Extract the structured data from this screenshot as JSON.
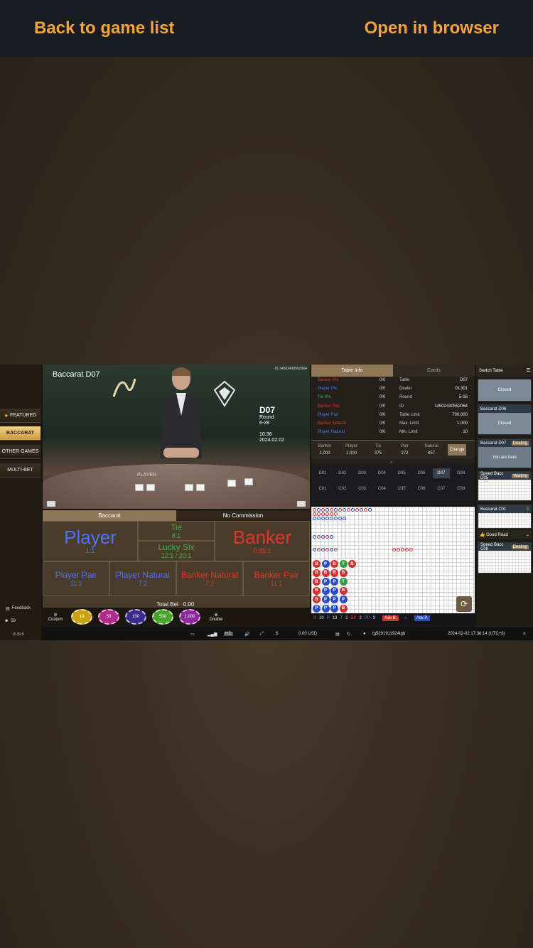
{
  "topbar": {
    "back": "Back to game list",
    "open": "Open in browser"
  },
  "nav": {
    "featured": "FEATURED",
    "baccarat": "BACCARAT",
    "other": "OTHER GAMES",
    "multi": "MULTI-BET",
    "feedback": "Feedback",
    "online": "59",
    "version": "r1.31.5"
  },
  "video": {
    "title": "Baccarat D07",
    "id": "ID 14502430552064",
    "table_code": "D07",
    "round_label": "Round",
    "round": "6-28",
    "time": "10:36",
    "date": "2024.02.02",
    "player_label": "PLAYER"
  },
  "bet": {
    "tab1": "Baccarat",
    "tab2": "No Commission",
    "player": "Player",
    "player_odds": "1:1",
    "tie": "Tie",
    "tie_odds": "8:1",
    "lucky": "Lucky Six",
    "lucky_odds": "12:1 / 20:1",
    "banker": "Banker",
    "banker_odds": "0.95:1",
    "player_pair": "Player Pair",
    "player_pair_odds": "11:1",
    "player_natural": "Player Natural",
    "player_natural_odds": "7:2",
    "banker_natural": "Banker Natural",
    "banker_natural_odds": "7:2",
    "banker_pair": "Banker Pair",
    "banker_pair_odds": "11:1",
    "total_label": "Total Bet",
    "total": "0.00",
    "custom": "Custom",
    "double": "Double",
    "chips": [
      "10",
      "50",
      "100",
      "500",
      "1,000"
    ]
  },
  "info": {
    "tab1": "Table Info",
    "tab2": "Cards",
    "left": [
      {
        "k": "Banker 0%",
        "v": "0/0",
        "c": "red"
      },
      {
        "k": "Player 0%",
        "v": "0/0",
        "c": "blue"
      },
      {
        "k": "Tie 0%",
        "v": "0/0",
        "c": "green"
      },
      {
        "k": "Banker Pair",
        "v": "0/0",
        "c": "red"
      },
      {
        "k": "Player Pair",
        "v": "0/0",
        "c": "blue"
      },
      {
        "k": "Banker Natural",
        "v": "0/0",
        "c": "red"
      },
      {
        "k": "Player Natural",
        "v": "0/0",
        "c": "blue"
      }
    ],
    "right": [
      {
        "k": "Table",
        "v": "D07"
      },
      {
        "k": "Dealer",
        "v": "DL301"
      },
      {
        "k": "Round",
        "v": "5-26"
      },
      {
        "k": "ID",
        "v": "14502430552064"
      },
      {
        "k": "Table Limit",
        "v": "700,000"
      },
      {
        "k": "Max. Limit",
        "v": "1,000"
      },
      {
        "k": "Min. Limit",
        "v": "10"
      }
    ],
    "limits": [
      {
        "k": "Banker",
        "v": "1,000"
      },
      {
        "k": "Player",
        "v": "1,000"
      },
      {
        "k": "Tie",
        "v": "375"
      },
      {
        "k": "Pair",
        "v": "272"
      },
      {
        "k": "Natural",
        "v": "857"
      }
    ],
    "change": "Change"
  },
  "tables": {
    "row1": [
      "D01",
      "D02",
      "D03",
      "D04",
      "D05",
      "D06",
      "D07",
      "D08"
    ],
    "row2": [
      "C01",
      "C02",
      "C03",
      "C04",
      "C05",
      "C06",
      "C07",
      "C08"
    ],
    "selected": "D07"
  },
  "road": {
    "beads": [
      [
        "B",
        "B",
        "B",
        "B",
        "B",
        "P",
        "P"
      ],
      [
        "P",
        "B",
        "P",
        "P",
        "P",
        "P",
        "P"
      ],
      [
        "B",
        "B",
        "P",
        "P",
        "P",
        "P",
        "P"
      ],
      [
        "T",
        "B",
        "T",
        "B",
        "P",
        "B",
        "P"
      ],
      [
        "B"
      ]
    ],
    "stats": [
      {
        "k": "B",
        "v": "10",
        "c": "#e2352c"
      },
      {
        "k": "P",
        "v": "13",
        "c": "#4c72ff"
      },
      {
        "k": "T",
        "v": "2",
        "c": "#39b54a"
      },
      {
        "k": "BP",
        "v": "2",
        "c": "#e2352c"
      },
      {
        "k": "PP",
        "v": "3",
        "c": "#4c72ff"
      }
    ],
    "ask_b": "Ask B.",
    "ask_p": "Ask P."
  },
  "switch": {
    "title": "Switch Table",
    "cards": [
      {
        "name": "",
        "status": "Closed"
      },
      {
        "name": "Baccarat D06",
        "status": "Closed"
      },
      {
        "name": "Baccarat D07",
        "state": "Dealing",
        "status": "You are here"
      },
      {
        "name": "Speed Bacc D05",
        "state": "Waiting"
      },
      {
        "name": "Baccarat C01",
        "state": "3"
      },
      {
        "name": "Good Road"
      },
      {
        "name": "Speed Bacc C08",
        "state": "Dealing"
      }
    ]
  },
  "status": {
    "hd": "HD",
    "balance": "0.00 USD",
    "user": "tg5291911924tgb",
    "datetime": "2024-02-02  17:36:14 (UTC+8)"
  },
  "colors": {
    "accent": "#f2a43a",
    "gold": "#8e7657",
    "banker": "#e2352c",
    "player": "#4c72ff",
    "tie": "#39b54a"
  }
}
